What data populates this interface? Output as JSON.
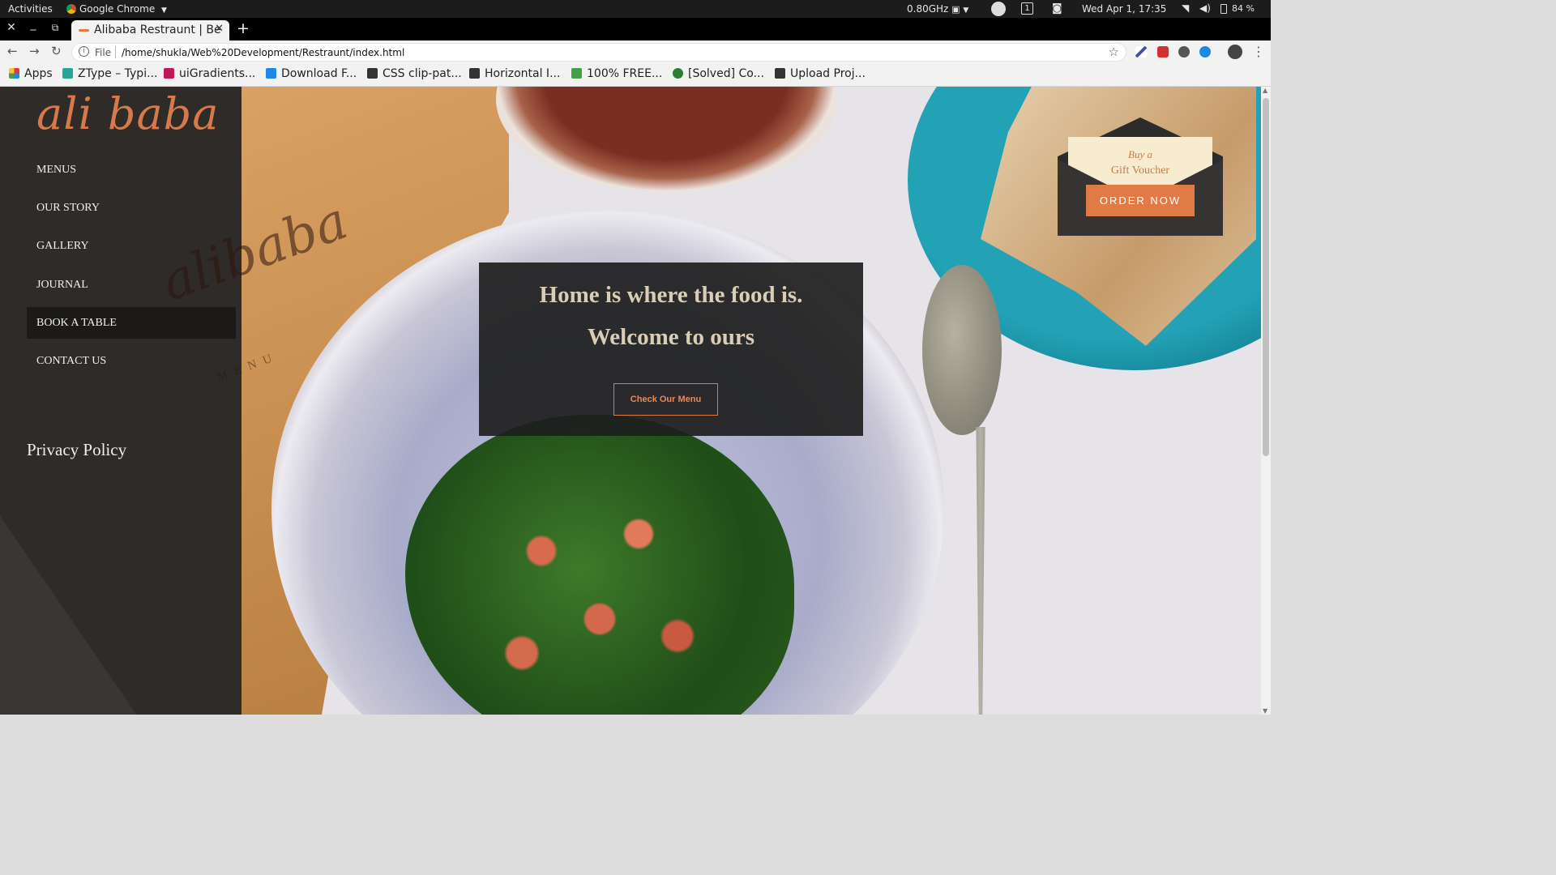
{
  "system_bar": {
    "activities": "Activities",
    "app_name": "Google Chrome",
    "cpu": "0.80GHz",
    "workspace": "1",
    "datetime": "Wed Apr  1, 17:35",
    "battery": "84 %"
  },
  "browser": {
    "tab_title": "Alibaba Restraunt | Be",
    "address_scheme": "File",
    "url": "/home/shukla/Web%20Development/Restraunt/index.html",
    "bookmarks": [
      {
        "label": "Apps",
        "icon": "apps-grid-icon",
        "color": "#e53935"
      },
      {
        "label": "ZType – Typi...",
        "icon": "ztype-icon",
        "color": "#26a69a"
      },
      {
        "label": "uiGradients...",
        "icon": "uigradients-icon",
        "color": "#c2185b"
      },
      {
        "label": "Download F...",
        "icon": "download-icon",
        "color": "#1e88e5"
      },
      {
        "label": "CSS clip-pat...",
        "icon": "clippy-icon",
        "color": "#333333"
      },
      {
        "label": "Horizontal I...",
        "icon": "codepen-icon",
        "color": "#333333"
      },
      {
        "label": "100% FREE...",
        "icon": "leaf-icon",
        "color": "#43a047"
      },
      {
        "label": "[Solved] Co...",
        "icon": "solved-icon",
        "color": "#2e7d32"
      },
      {
        "label": "Upload Proj...",
        "icon": "tm-icon",
        "color": "#333333"
      }
    ]
  },
  "site": {
    "logo_text": "ali baba",
    "nav": [
      "MENUS",
      "OUR STORY",
      "GALLERY",
      "JOURNAL",
      "BOOK A TABLE",
      "CONTACT US"
    ],
    "active_nav": "BOOK A TABLE",
    "privacy": "Privacy Policy",
    "watermark": "alibaba",
    "watermark_sub": "MENU",
    "hero_line1": "Home is where the food is.",
    "hero_line2": "Welcome to ours",
    "menu_button": "Check Our Menu",
    "voucher_line1": "Buy a",
    "voucher_line2": "Gift Voucher",
    "order_button": "ORDER NOW"
  },
  "colors": {
    "accent": "#e07a47",
    "sidebar": "#2f2b28",
    "logo": "#d67a4c"
  }
}
